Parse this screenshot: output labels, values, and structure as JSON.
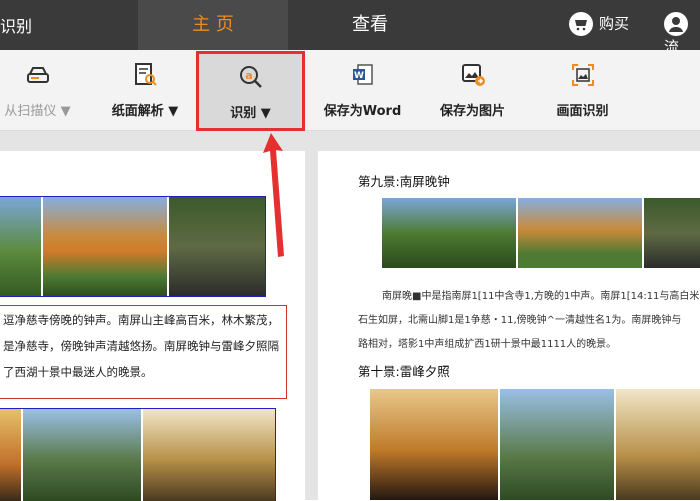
{
  "topbar": {
    "left_partial": "识别",
    "tabs": [
      {
        "label": "主 页",
        "active": true
      },
      {
        "label": "查看",
        "active": false
      }
    ],
    "buy_label": "购买",
    "user_partial": "流"
  },
  "toolbar": {
    "items": [
      {
        "id": "scan",
        "label": "从扫描仪",
        "arrow": "▼",
        "disabled": true,
        "icon": "scanner-icon"
      },
      {
        "id": "page-analysis",
        "label": "纸面解析",
        "arrow": "▼",
        "icon": "document-search-icon"
      },
      {
        "id": "recognize",
        "label": "识别",
        "arrow": "▼",
        "selected": true,
        "icon": "text-recognize-icon"
      },
      {
        "id": "save-word",
        "label": "保存为Word",
        "icon": "word-icon"
      },
      {
        "id": "save-image",
        "label": "保存为图片",
        "icon": "image-export-icon"
      },
      {
        "id": "screen-recognize",
        "label": "画面识别",
        "icon": "screen-capture-icon"
      }
    ]
  },
  "left_page": {
    "lines": [
      "逗净慈寺傍晚的钟声。南屏山主峰高百米，林木繁茂，",
      "是净慈寺，傍晚钟声清越悠扬。南屏晚钟与雷峰夕照隔",
      "了西湖十景中最迷人的晚景。"
    ]
  },
  "right_page": {
    "heading1": "第九景:南屏晚钟",
    "ocr_lines": [
      "南屏晚■中是指南屏1[11中含寺1,方晚的1中声。南屏1[14:11与高白米，林",
      "石生如屏，北需山脚1是1争慈・11,傍晚钟^一清越性名1为。南屏晚钟与",
      "路相对，塔影1中声组成扩西1研十景中最1111人的晚景。"
    ],
    "heading2": "第十景:雷峰夕照"
  },
  "colors": {
    "topbar_bg": "#3a3a3a",
    "accent": "#f08c1e",
    "selection_border": "#e53030"
  }
}
